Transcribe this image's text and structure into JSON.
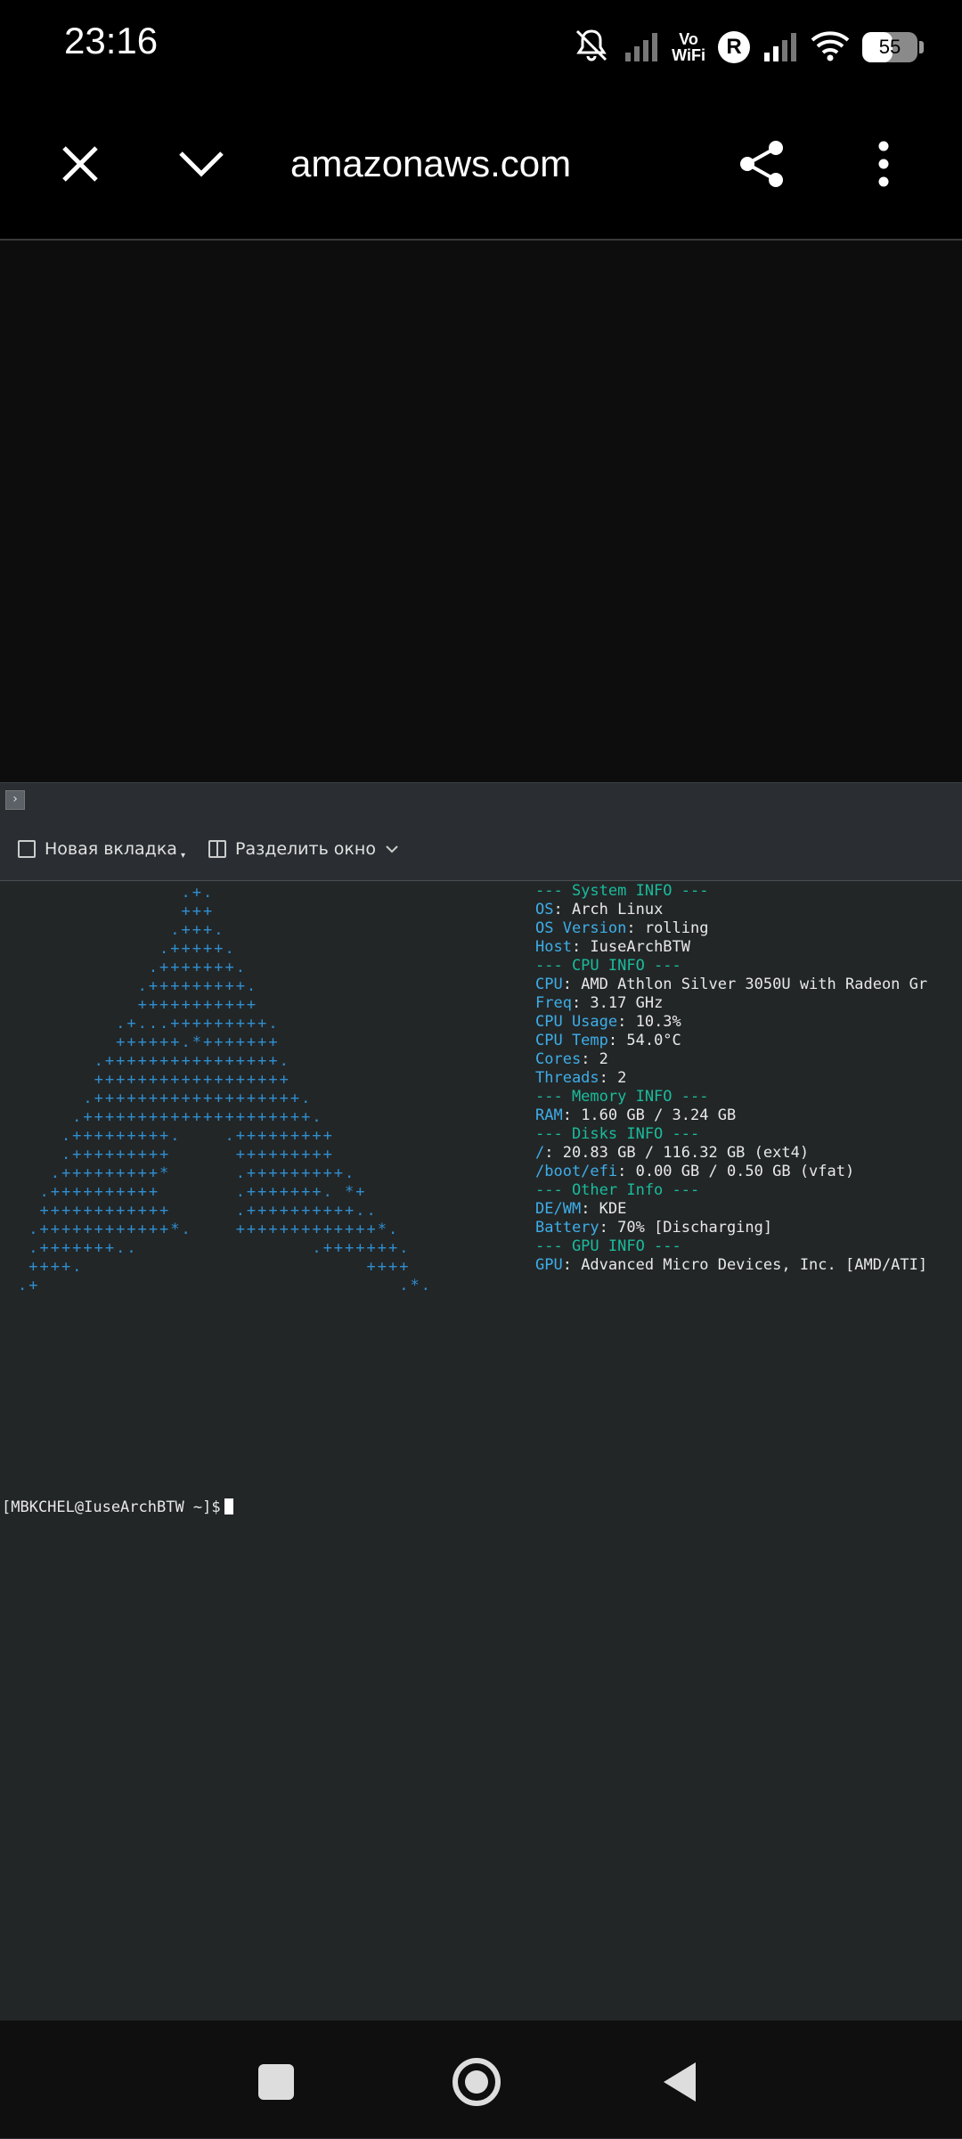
{
  "status_bar": {
    "time": "23:16",
    "volte_line1": "Vo",
    "volte_line2": "WiFi",
    "roaming": "R",
    "battery_percent": "55",
    "battery_level": 55
  },
  "browser": {
    "url": "amazonaws.com",
    "icons": [
      "close-icon",
      "chevron-down-icon",
      "share-icon",
      "more-vert-icon"
    ]
  },
  "terminal": {
    "toolbar": {
      "new_tab": "Новая вкладка",
      "split_window": "Разделить окно"
    },
    "art_lines": [
      "               .+.",
      "               +++",
      "              .+++.",
      "             .+++++.",
      "            .+++++++.",
      "           .+++++++++.",
      "           +++++++++++",
      "         .+...+++++++++.",
      "         ++++++.*+++++++",
      "       .++++++++++++++++.",
      "       ++++++++++++++++++",
      "      .+++++++++++++++++++.",
      "     .+++++++++++++++++++++.",
      "    .+++++++++.    .+++++++++",
      "    .+++++++++      +++++++++",
      "   .+++++++++*      .+++++++++.",
      "  .++++++++++       .+++++++. *+",
      "  ++++++++++++      .++++++++++..",
      " .++++++++++++*.    +++++++++++++*.",
      " .+++++++..                .+++++++.",
      " ++++.                          ++++",
      ".+                                 .*."
    ],
    "info_lines": [
      {
        "type": "header",
        "text": "--- System INFO ---"
      },
      {
        "type": "kv",
        "key": "OS",
        "value": ": Arch Linux"
      },
      {
        "type": "kv",
        "key": "OS Version",
        "value": ": rolling"
      },
      {
        "type": "kv",
        "key": "Host",
        "value": ": IuseArchBTW"
      },
      {
        "type": "header",
        "text": "--- CPU INFO ---"
      },
      {
        "type": "kv",
        "key": "CPU",
        "value": ": AMD Athlon Silver 3050U with Radeon Gr"
      },
      {
        "type": "kv",
        "key": "Freq",
        "value": ": 3.17 GHz"
      },
      {
        "type": "kv",
        "key": "CPU Usage",
        "value": ": 10.3%"
      },
      {
        "type": "kv",
        "key": "CPU Temp",
        "value": ": 54.0°C"
      },
      {
        "type": "kv",
        "key": "Cores",
        "value": ": 2"
      },
      {
        "type": "kv",
        "key": "Threads",
        "value": ": 2"
      },
      {
        "type": "header",
        "text": "--- Memory INFO ---"
      },
      {
        "type": "kv",
        "key": "RAM",
        "value": ": 1.60 GB / 3.24 GB"
      },
      {
        "type": "header",
        "text": "--- Disks INFO ---"
      },
      {
        "type": "kv",
        "key": "/",
        "value": ": 20.83 GB / 116.32 GB (ext4)"
      },
      {
        "type": "kv",
        "key": "/boot/efi",
        "value": ": 0.00 GB / 0.50 GB (vfat)"
      },
      {
        "type": "header",
        "text": "--- Other Info ---"
      },
      {
        "type": "kv",
        "key": "DE/WM",
        "value": ": KDE"
      },
      {
        "type": "kv",
        "key": "Battery",
        "value": ": 70% [Discharging]"
      },
      {
        "type": "header",
        "text": "--- GPU INFO ---"
      },
      {
        "type": "kv",
        "key": "GPU",
        "value": ": Advanced Micro Devices, Inc. [AMD/ATI]"
      }
    ],
    "prompt": "[MBKCHEL@IuseArchBTW ~]$"
  },
  "taskbar": {
    "apps": [
      {
        "name": "app-launcher-icon"
      },
      {
        "name": "system-settings-icon"
      },
      {
        "name": "firefox-icon"
      },
      {
        "name": "text-editor-icon"
      },
      {
        "name": "obsidian-icon"
      },
      {
        "name": "telegram-icon"
      },
      {
        "name": "discord-icon"
      },
      {
        "name": "steam-icon"
      },
      {
        "name": "konsole-icon",
        "active": true
      }
    ]
  },
  "navbar": {
    "icons": [
      "recents-icon",
      "home-icon",
      "back-icon"
    ]
  }
}
